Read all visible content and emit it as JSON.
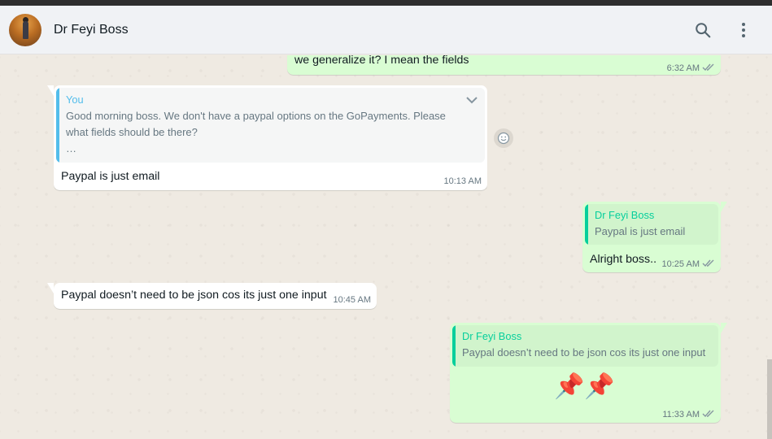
{
  "header": {
    "contact_name": "Dr Feyi Boss",
    "avatar_icon": "contact-avatar",
    "search_icon": "search-icon",
    "menu_icon": "more-vert-icon"
  },
  "colors": {
    "incoming_bubble": "#ffffff",
    "outgoing_bubble": "#d9fdd3",
    "you_quote_accent": "#53bdeb",
    "contact_quote_accent": "#06cf9c",
    "read_ticks": "#667781"
  },
  "messages": [
    {
      "direction": "outgoing",
      "text": "we generalize it? I mean the fields",
      "time": "6:32 AM",
      "status": "double-check-icon"
    },
    {
      "direction": "incoming",
      "quote": {
        "author": "You",
        "text_line1": "Good morning boss. We don't have a paypal options on the GoPayments. Please",
        "text_line2": "what fields should be there?",
        "text_line3": "…"
      },
      "text": "Paypal is just email",
      "time": "10:13 AM"
    },
    {
      "direction": "outgoing",
      "quote": {
        "author": "Dr Feyi Boss",
        "text": "Paypal is just email"
      },
      "text": "Alright boss..",
      "time": "10:25 AM",
      "status": "double-check-icon"
    },
    {
      "direction": "incoming",
      "text": "Paypal doesn’t need to be json cos its just one input",
      "time": "10:45 AM"
    },
    {
      "direction": "outgoing",
      "quote": {
        "author": "Dr Feyi Boss",
        "text": "Paypal doesn’t need to be json cos its just one input"
      },
      "text": "📌📌",
      "time": "11:33 AM",
      "status": "double-check-icon"
    }
  ]
}
